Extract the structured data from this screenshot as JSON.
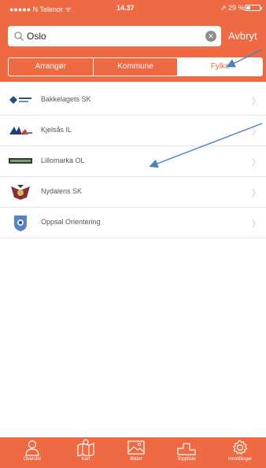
{
  "status_bar": {
    "carrier": "●●●●● N Telenor ᯤ",
    "time": "14.37",
    "battery": "⇗ 29 %",
    "battery_level": 0.29
  },
  "search": {
    "value": "Oslo",
    "cancel_label": "Avbryt"
  },
  "segments": [
    {
      "label": "Arrangør",
      "active": false
    },
    {
      "label": "Kommune",
      "active": false
    },
    {
      "label": "Fylke",
      "active": true
    }
  ],
  "clubs": [
    {
      "name": "Bakkelagets SK"
    },
    {
      "name": "Kjelsås IL"
    },
    {
      "name": "Lillomarka OL"
    },
    {
      "name": "Nydalens SK"
    },
    {
      "name": "Oppsal Orientering"
    }
  ],
  "tabs": [
    {
      "label": "Oversikt",
      "icon": "person-icon"
    },
    {
      "label": "Kart",
      "icon": "map-icon"
    },
    {
      "label": "Bilder",
      "icon": "image-icon"
    },
    {
      "label": "Toppliste",
      "icon": "podium-icon"
    },
    {
      "label": "Innstillinger",
      "icon": "gear-icon"
    }
  ],
  "colors": {
    "accent": "#ef6a42",
    "annotation_arrow": "#4a7fc1"
  }
}
